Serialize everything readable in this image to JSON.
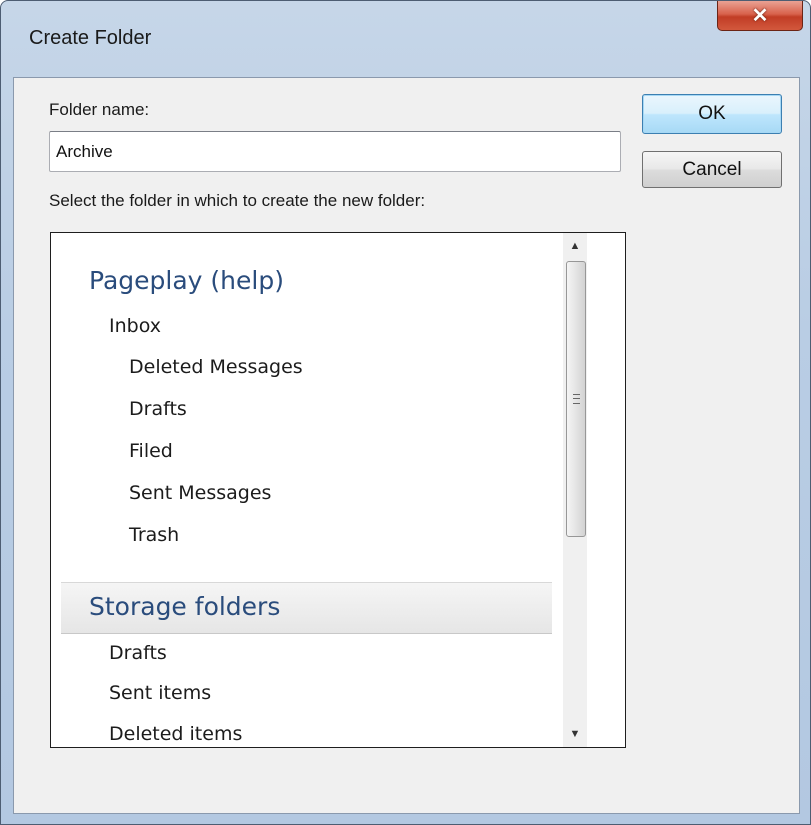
{
  "window": {
    "title": "Create Folder",
    "close_icon": "close-icon"
  },
  "form": {
    "folder_name_label": "Folder name:",
    "folder_name_value": "Archive",
    "select_prompt": "Select the folder in which to create the new folder:"
  },
  "buttons": {
    "ok_label": "OK",
    "cancel_label": "Cancel"
  },
  "tree": {
    "groups": [
      {
        "header": "Pageplay (help)",
        "items": [
          {
            "label": "Inbox",
            "level": 1
          },
          {
            "label": "Deleted Messages",
            "level": 2
          },
          {
            "label": "Drafts",
            "level": 2
          },
          {
            "label": "Filed",
            "level": 2
          },
          {
            "label": "Sent Messages",
            "level": 2
          },
          {
            "label": "Trash",
            "level": 2
          }
        ]
      },
      {
        "header": "Storage folders",
        "selected": true,
        "items": [
          {
            "label": "Drafts",
            "level": 1
          },
          {
            "label": "Sent items",
            "level": 1
          },
          {
            "label": "Deleted items",
            "level": 1
          }
        ]
      }
    ]
  },
  "colors": {
    "group_header_text": "#2a4c7c",
    "close_button": "#c13d25",
    "dialog_background": "#f0f0f0"
  }
}
